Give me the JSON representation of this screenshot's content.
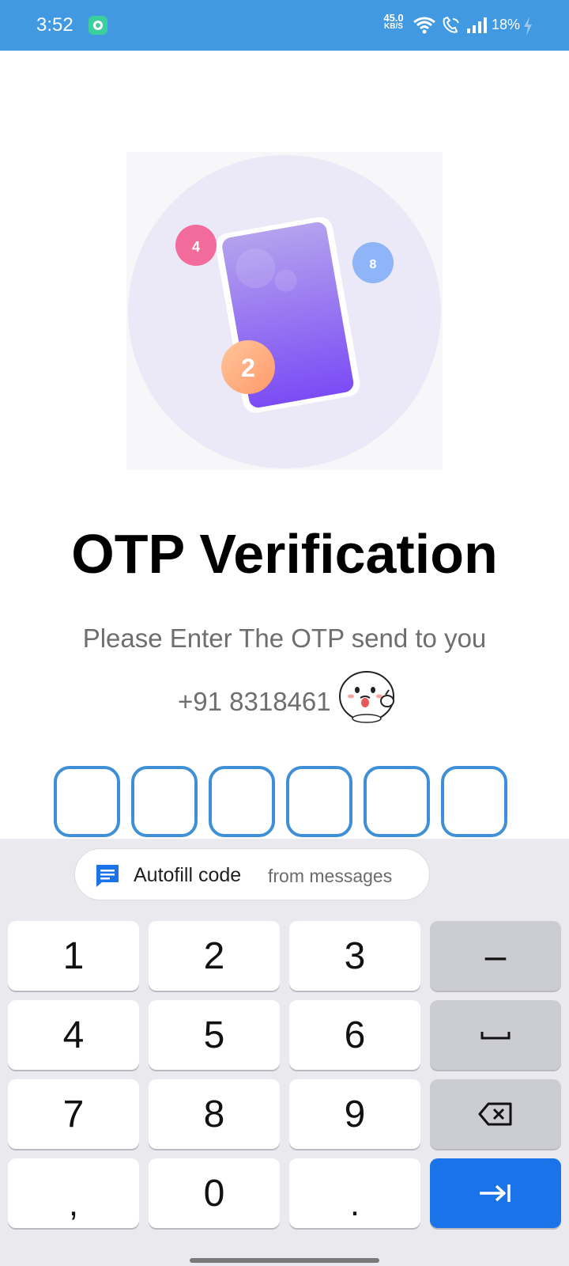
{
  "status_bar": {
    "time": "3:52",
    "net_speed_value": "45.0",
    "net_speed_unit": "KB/S",
    "battery": "18%"
  },
  "illustration": {
    "bubble_left": "4",
    "bubble_right": "8",
    "bubble_bottom": "2"
  },
  "title": "OTP Verification",
  "subtitle": "Please Enter The OTP send to you",
  "phone": "+91 8318461",
  "otp": {
    "boxes": [
      "",
      "",
      "",
      "",
      "",
      ""
    ]
  },
  "keyboard": {
    "autofill_label": "Autofill code",
    "autofill_source": "from messages",
    "keys": {
      "k1": "1",
      "k2": "2",
      "k3": "3",
      "minus": "–",
      "k4": "4",
      "k5": "5",
      "k6": "6",
      "k7": "7",
      "k8": "8",
      "k9": "9",
      "comma": ",",
      "k0": "0",
      "period": "."
    }
  },
  "colors": {
    "status_bar": "#4199e1",
    "otp_border": "#3e8fd6",
    "enter_key": "#1a73e8",
    "keyboard_bg": "#eaeaee"
  }
}
